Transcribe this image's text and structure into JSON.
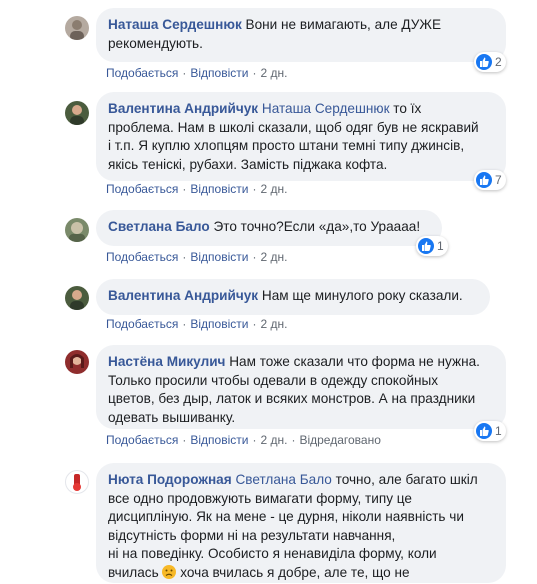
{
  "actions": {
    "like": "Подобається",
    "reply": "Відповісти",
    "edited": "Відредаговано"
  },
  "comments": [
    {
      "author": "Наташа Сердешнюк",
      "lines": [
        "Вони не вимагають, але ДУЖЕ",
        "рекомендують."
      ],
      "time": "2 дн.",
      "reactions": "2"
    },
    {
      "author": "Валентина Андрийчук",
      "tag": "Наташа Сердешнюк",
      "lines": [
        " то їх",
        "проблема. Нам в школі сказали, щоб одяг був не яскравий",
        "і т.п. Я куплю хлопцям просто штани темні типу джинсів,",
        "якісь теніскі, рубахи. Замість піджака кофта."
      ],
      "time": "2 дн.",
      "reactions": "7"
    },
    {
      "author": "Светлана Бало",
      "lines": [
        "Это точно?Если «да»,то Ураааа!"
      ],
      "time": "2 дн.",
      "reactions": "1"
    },
    {
      "author": "Валентина Андрийчук",
      "lines": [
        "Нам ще минулого року сказали."
      ],
      "time": "2 дн."
    },
    {
      "author": "Настёна Микулич",
      "lines": [
        "Нам тоже сказали что форма не нужна.",
        "Только просили чтобы одевали в одежду спокойных",
        "цветов, без дыр, латок и всяких монстров. А на праздники",
        "одевать вышиванку."
      ],
      "time": "2 дн.",
      "reactions": "1"
    },
    {
      "author": "Нюта Подорожная",
      "tag": "Светлана Бало",
      "lines": [
        " точно, але багато шкіл",
        "все одно продовжують вимагати форму, типу це",
        "дисципліную. Як на мене - це дурня, ніколи наявність чи",
        "відсутність форми ні на результати навчання,",
        "ні на поведінку. Особисто я ненавиділа форму, коли",
        "вчилась",
        " хоча вчилась я добре, але те, що не"
      ]
    }
  ]
}
